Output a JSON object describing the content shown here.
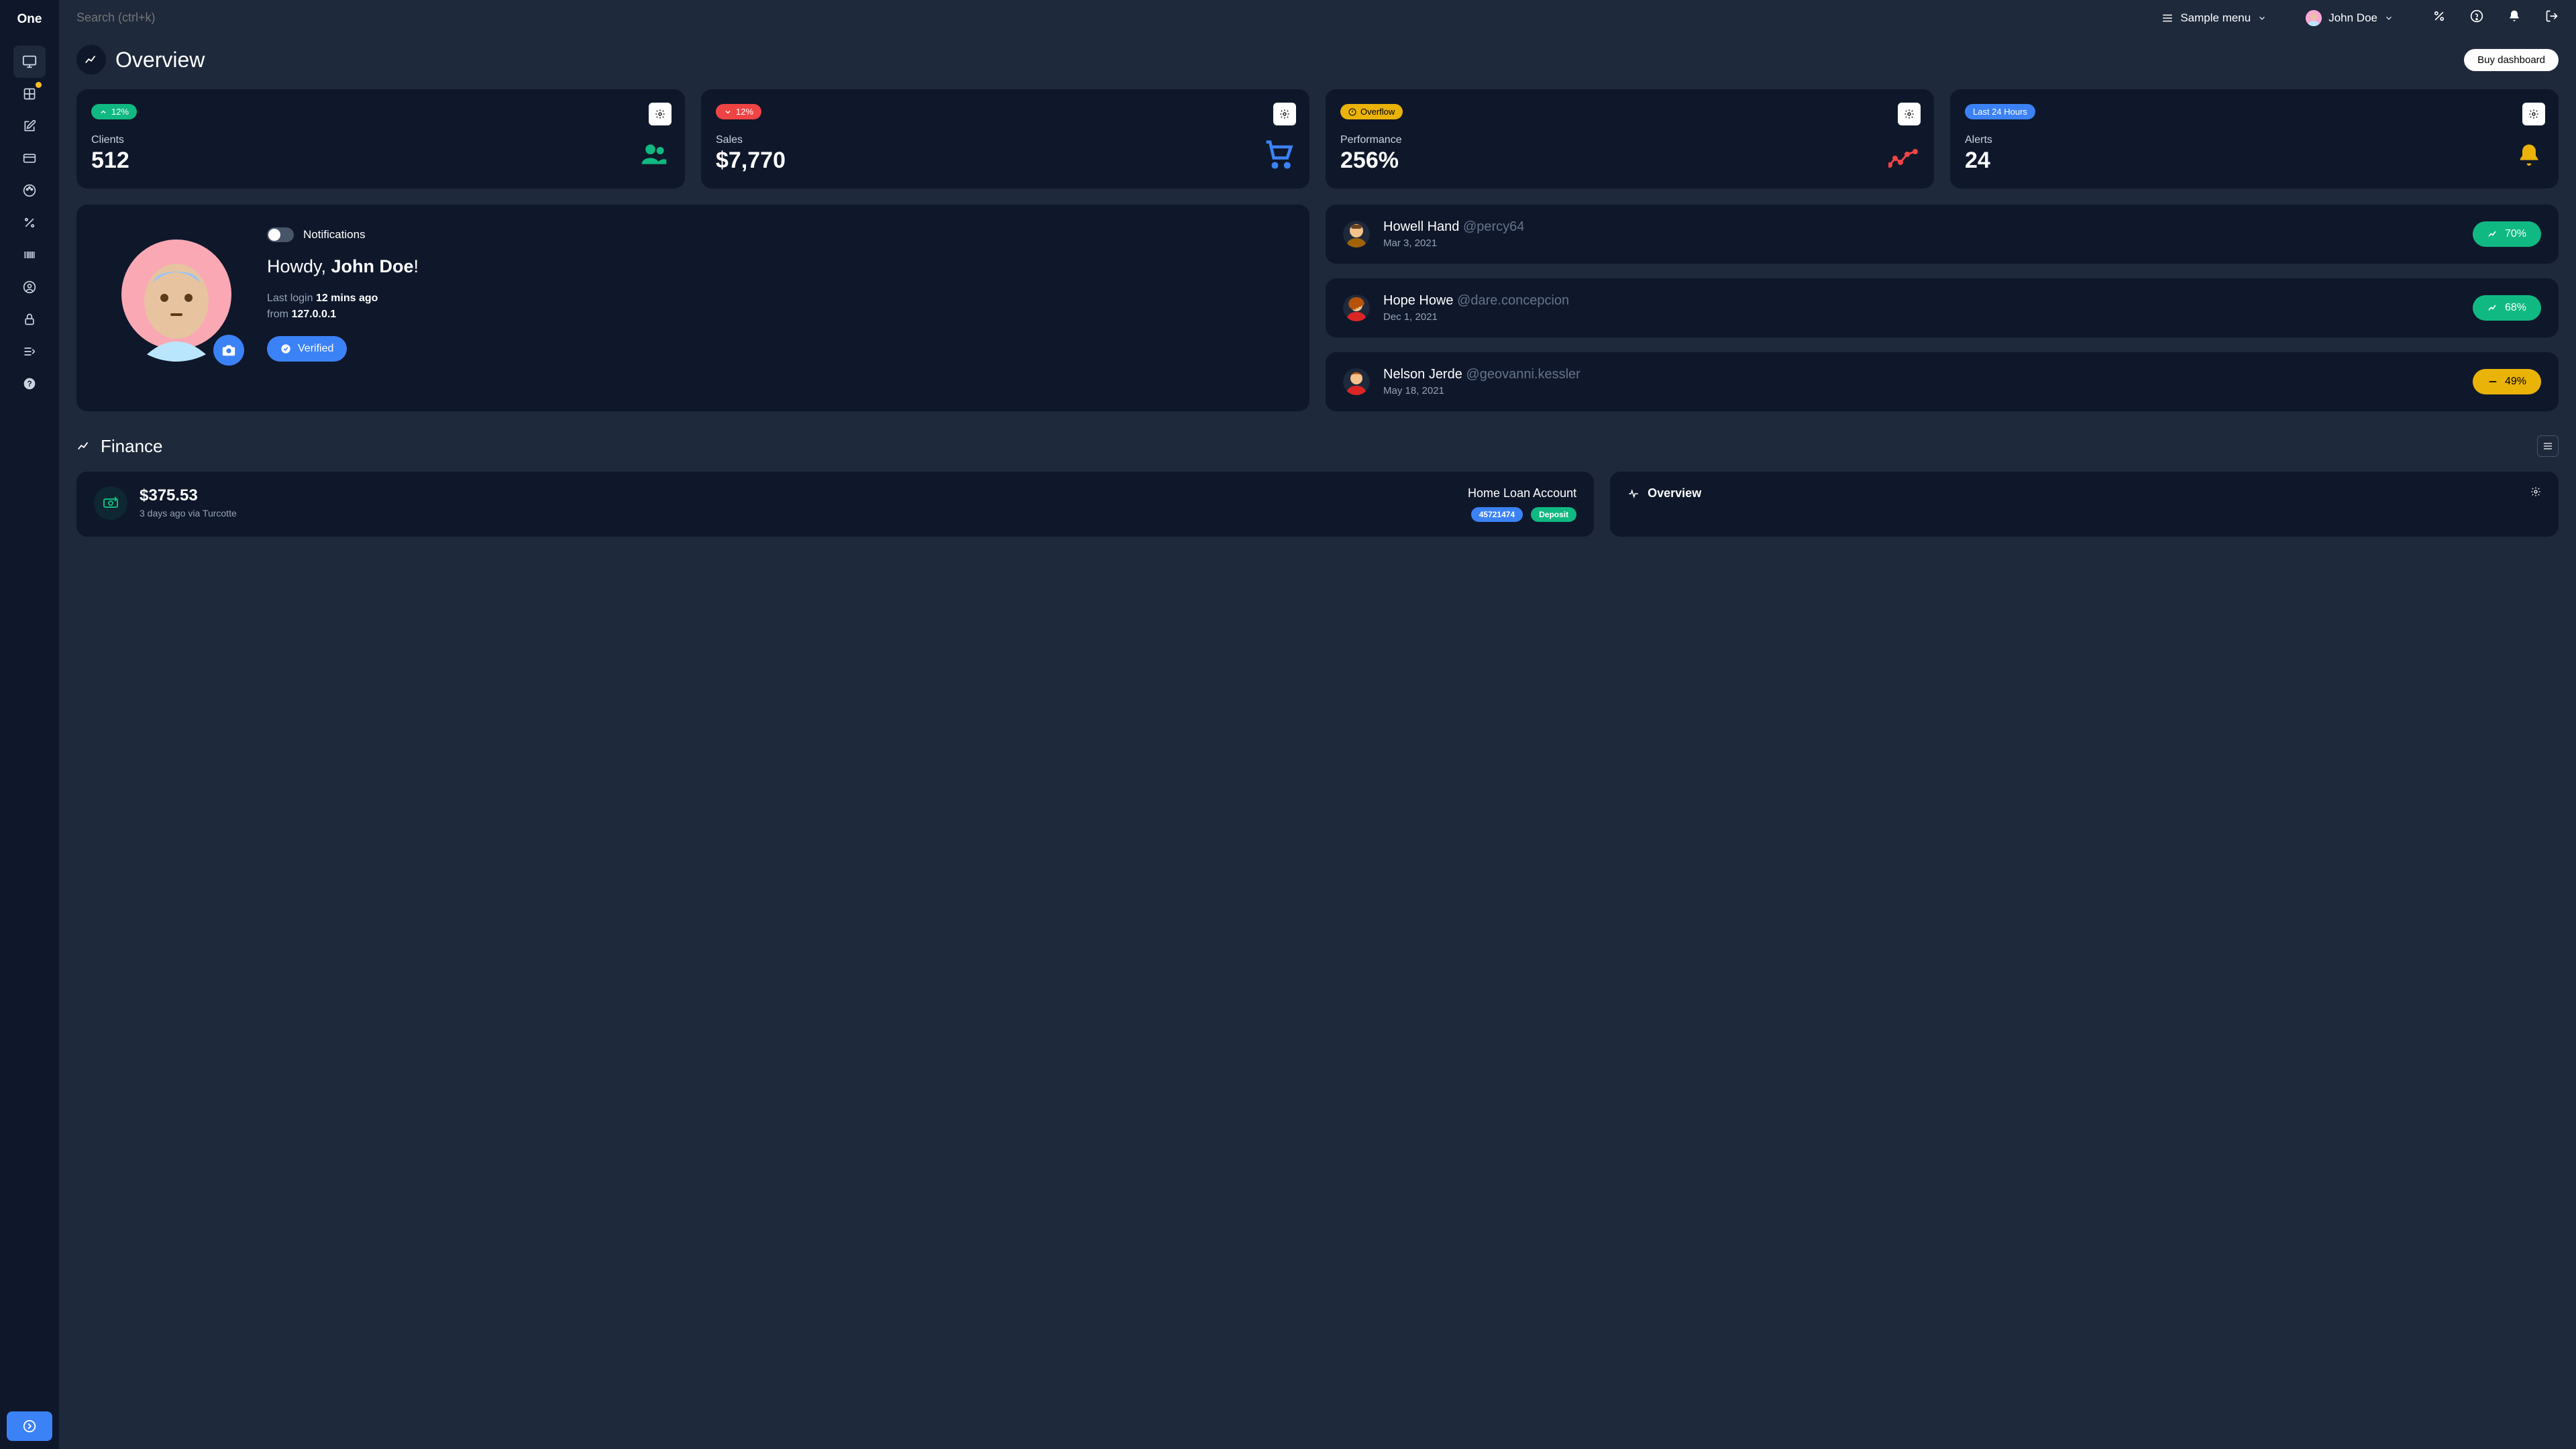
{
  "brand": "One",
  "search_placeholder": "Search (ctrl+k)",
  "top_menu_label": "Sample menu",
  "user": {
    "name": "John Doe"
  },
  "overview": {
    "title": "Overview",
    "cta": "Buy dashboard"
  },
  "stats": {
    "clients": {
      "pill": "12%",
      "label": "Clients",
      "value": "512"
    },
    "sales": {
      "pill": "12%",
      "label": "Sales",
      "value": "$7,770"
    },
    "perf": {
      "pill": "Overflow",
      "label": "Performance",
      "value": "256%"
    },
    "alerts": {
      "pill": "Last 24 Hours",
      "label": "Alerts",
      "value": "24"
    }
  },
  "profile": {
    "notifications_label": "Notifications",
    "greeting_prefix": "Howdy, ",
    "greeting_name": "John Doe",
    "greeting_suffix": "!",
    "login_prefix": "Last login ",
    "login_time": "12 mins ago",
    "from_prefix": "from ",
    "from_ip": "127.0.0.1",
    "verified_label": "Verified"
  },
  "people": [
    {
      "name": "Howell Hand",
      "handle": "@percy64",
      "date": "Mar 3, 2021",
      "pct": "70%",
      "tone": "green"
    },
    {
      "name": "Hope Howe",
      "handle": "@dare.concepcion",
      "date": "Dec 1, 2021",
      "pct": "68%",
      "tone": "green"
    },
    {
      "name": "Nelson Jerde",
      "handle": "@geovanni.kessler",
      "date": "May 18, 2021",
      "pct": "49%",
      "tone": "yellow"
    }
  ],
  "finance": {
    "title": "Finance",
    "amount": "$375.53",
    "sub": "3 days ago via Turcotte",
    "account_name": "Home Loan Account",
    "account_no": "45721474",
    "deposit_label": "Deposit",
    "overview_label": "Overview"
  }
}
